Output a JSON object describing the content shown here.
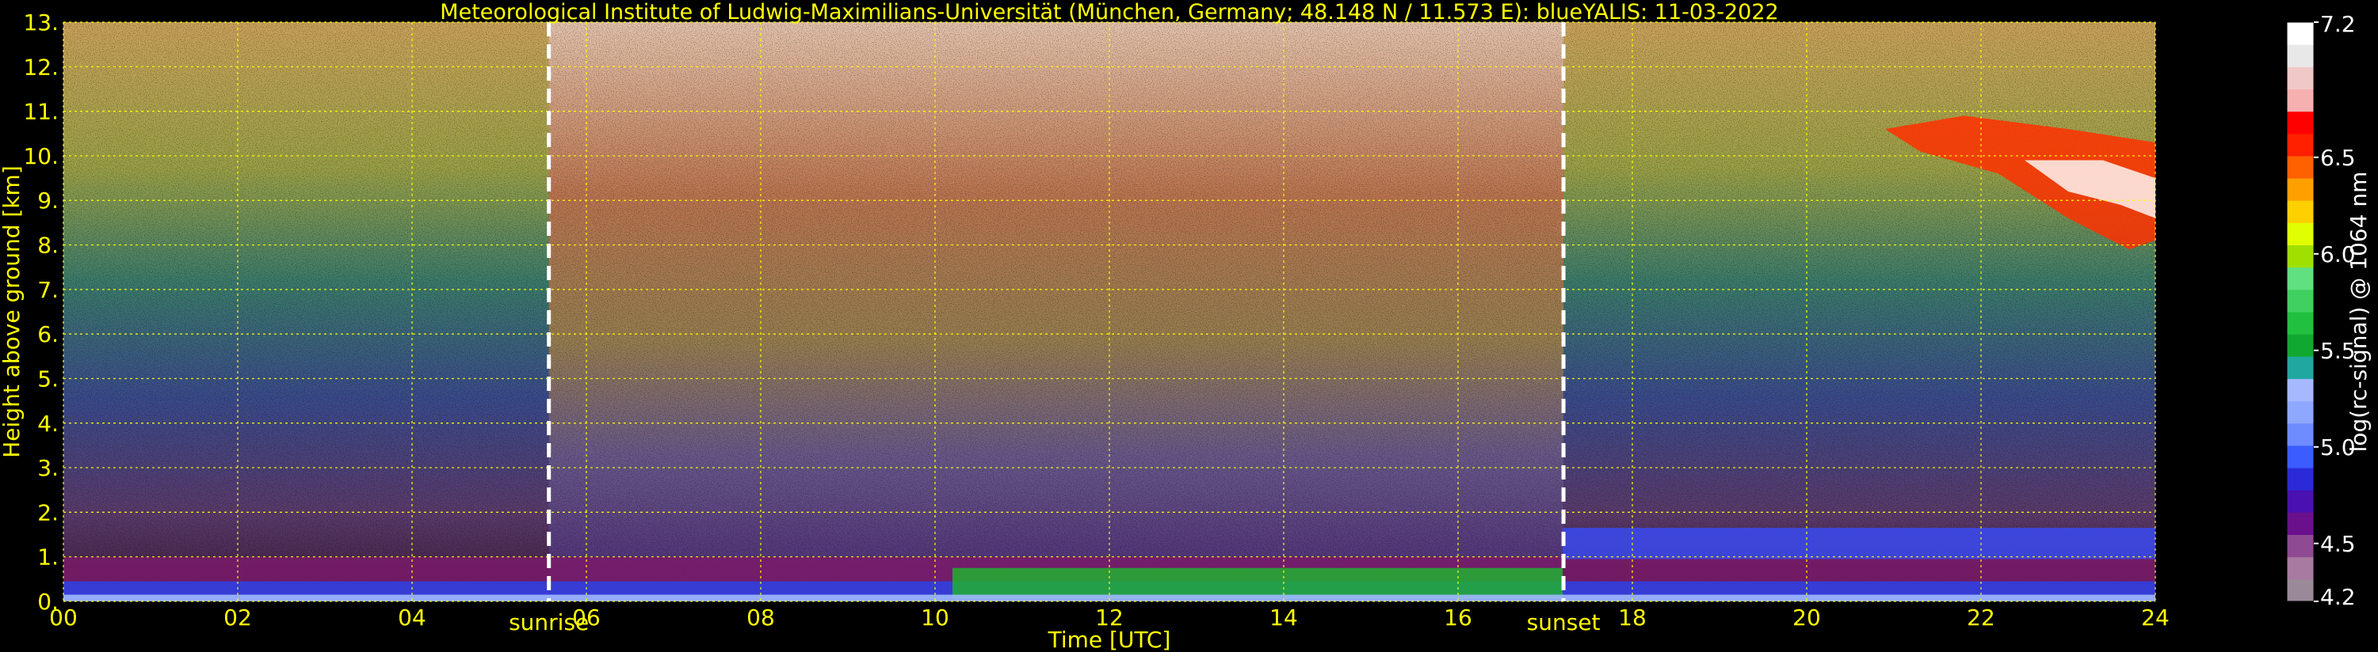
{
  "chart_data": {
    "type": "heatmap",
    "title": "Meteorological Institute of Ludwig-Maximilians-Universität (München, Germany; 48.148 N / 11.573 E):     blueYALIS: 11-03-2022",
    "xlabel": "Time [UTC]",
    "ylabel": "Height above ground [km]",
    "xlim": [
      0,
      24
    ],
    "ylim": [
      0,
      13
    ],
    "x_ticks": [
      "00",
      "02",
      "04",
      "06",
      "08",
      "10",
      "12",
      "14",
      "16",
      "18",
      "20",
      "22",
      "24"
    ],
    "y_ticks": [
      "0.",
      "1.",
      "2.",
      "3.",
      "4.",
      "5.",
      "6.",
      "7.",
      "8.",
      "9.",
      "10.",
      "11.",
      "12.",
      "13."
    ],
    "grid": true,
    "markers": [
      {
        "label": "sunrise",
        "time": 5.57
      },
      {
        "label": "sunset",
        "time": 17.21
      }
    ],
    "colorbar": {
      "label": "log(rc-signal) @ 1064 nm",
      "range": [
        4.2,
        7.2
      ],
      "ticks": [
        "7.2",
        "6.5",
        "6.0",
        "5.5",
        "5.0",
        "4.5",
        "4.2"
      ],
      "tick_values": [
        7.2,
        6.5,
        6.0,
        5.5,
        5.0,
        4.5,
        4.2
      ],
      "colors": [
        "#9a8a98",
        "#a87aa2",
        "#8e4a92",
        "#6a108c",
        "#4a10b0",
        "#2a2ad8",
        "#3b5cff",
        "#6f8cff",
        "#8fa8ff",
        "#a6b8ff",
        "#20a8a0",
        "#10a830",
        "#22c040",
        "#40d060",
        "#60e080",
        "#a0e000",
        "#e0ff00",
        "#ffd000",
        "#ffa000",
        "#ff6000",
        "#ff2000",
        "#ff0000",
        "#f6b0b0",
        "#f0c8c8",
        "#e8e8e8",
        "#ffffff"
      ]
    }
  }
}
